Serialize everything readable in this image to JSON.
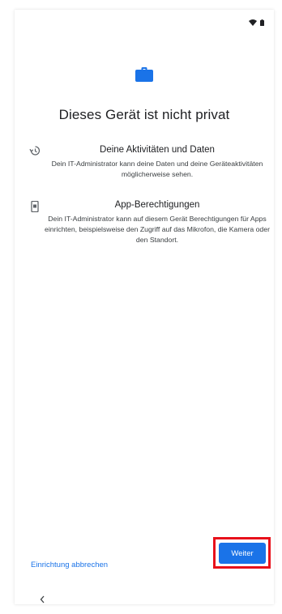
{
  "status_bar": {
    "icons": [
      "wifi-icon",
      "battery-icon"
    ]
  },
  "header": {
    "icon": "briefcase-icon",
    "title": "Dieses Gerät ist nicht privat"
  },
  "info_items": [
    {
      "icon": "history-icon",
      "title": "Deine Aktivitäten und Daten",
      "body": "Dein IT-Administrator kann deine Daten und deine Geräteaktivitäten möglicherweise sehen."
    },
    {
      "icon": "device-app-icon",
      "title": "App-Berechtigungen",
      "body": "Dein IT-Administrator kann auf diesem Gerät Berechtigungen für Apps einrichten, beispielsweise den Zugriff auf das Mikrofon, die Kamera oder den Standort."
    }
  ],
  "footer": {
    "cancel_label": "Einrichtung abbrechen",
    "next_label": "Weiter"
  },
  "nav": {
    "back_icon": "chevron-left-icon"
  },
  "colors": {
    "accent": "#1a73e8",
    "highlight": "#e8111b",
    "text_primary": "#202124",
    "text_secondary": "#3c4043"
  }
}
